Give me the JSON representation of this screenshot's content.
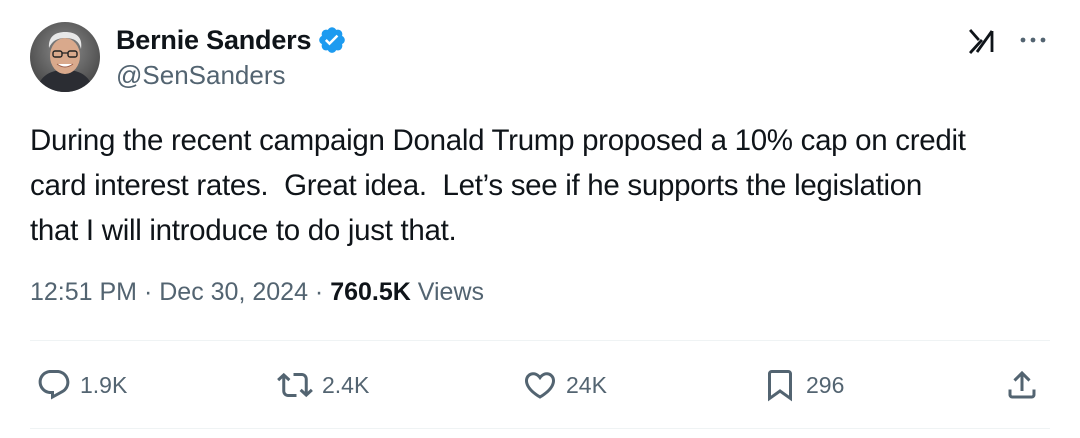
{
  "author": {
    "display_name": "Bernie Sanders",
    "handle": "@SenSanders",
    "verified": true,
    "verified_color": "#1d9bf0"
  },
  "tweet": {
    "text": "During the recent campaign Donald Trump proposed a 10% cap on credit\ncard interest rates.  Great idea.  Let’s see if he supports the legislation\nthat I will introduce to do just that.",
    "time": "12:51 PM",
    "separator": "·",
    "date": "Dec 30, 2024",
    "views_count": "760.5K",
    "views_label": "Views"
  },
  "actions": {
    "replies": "1.9K",
    "reposts": "2.4K",
    "likes": "24K",
    "bookmarks": "296"
  },
  "icons": {
    "grok": "grok-icon",
    "more": "more-icon",
    "reply": "reply-icon",
    "repost": "repost-icon",
    "like": "like-icon",
    "bookmark": "bookmark-icon",
    "share": "share-icon"
  },
  "colors": {
    "text_primary": "#0f1419",
    "text_secondary": "#536471",
    "divider": "#eff3f4"
  }
}
